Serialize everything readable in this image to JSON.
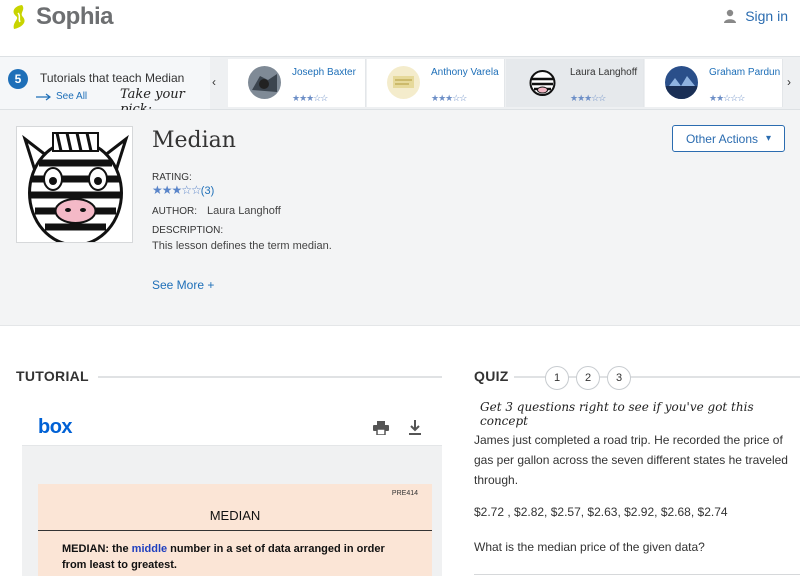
{
  "header": {
    "brand": "Sophia",
    "signin_label": "Sign in"
  },
  "strip": {
    "count": "5",
    "title": "Tutorials that teach Median",
    "see_all": "See All",
    "pick_text": "Take your pick:",
    "tutorials": [
      {
        "name": "Joseph Baxter",
        "rating_stars": "★★★☆☆"
      },
      {
        "name": "Anthony Varela",
        "rating_stars": "★★★☆☆"
      },
      {
        "name": "Laura Langhoff",
        "rating_stars": "★★★☆☆"
      },
      {
        "name": "Graham Pardun",
        "rating_stars": "★★☆☆☆"
      }
    ]
  },
  "lesson": {
    "title": "Median",
    "other_actions": "Other Actions",
    "rating_label": "RATING:",
    "rating_stars": "★★★☆☆",
    "rating_count": "(3)",
    "author_label": "AUTHOR:",
    "author": "Laura Langhoff",
    "description_label": "DESCRIPTION:",
    "description": "This lesson defines the term median.",
    "see_more": "See More +"
  },
  "tutorial": {
    "heading": "TUTORIAL",
    "viewer_brand": "box",
    "doc": {
      "code": "PRE414",
      "title": "MEDIAN",
      "def_prefix": "MEDIAN:  the ",
      "def_highlight": "middle",
      "def_suffix": " number in a set of data arranged in order from least to greatest."
    }
  },
  "quiz": {
    "heading": "QUIZ",
    "numbers": [
      "1",
      "2",
      "3"
    ],
    "tagline": "Get 3 questions right to see if you've got this concept",
    "question": "James just completed a road trip. He recorded the price of gas per gallon across the seven different states he traveled through.",
    "prices": "$2.72 ,  $2.82, $2.57, $2.63, $2.92, $2.68, $2.74",
    "ask": "What is the median price of the given data?"
  },
  "colors": {
    "link_blue": "#1e6fb8",
    "doc_bg": "#fbe5d6",
    "box_blue": "#0061d5"
  }
}
